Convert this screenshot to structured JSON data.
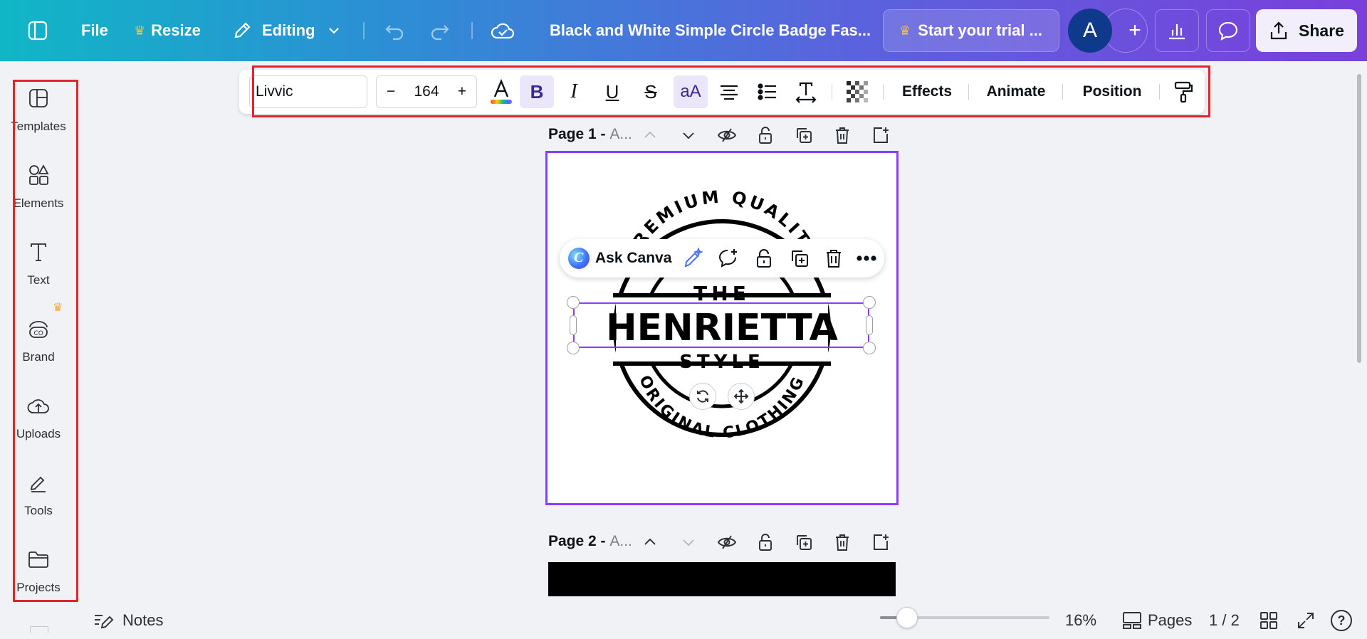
{
  "header": {
    "file_label": "File",
    "resize_label": "Resize",
    "editing_label": "Editing",
    "doc_title": "Black and White Simple Circle Badge Fas...",
    "trial_label": "Start your trial ...",
    "avatar_letter": "A",
    "plus_label": "+",
    "share_label": "Share"
  },
  "sidebar": {
    "items": [
      {
        "label": "Templates",
        "icon": "templates-icon"
      },
      {
        "label": "Elements",
        "icon": "elements-icon"
      },
      {
        "label": "Text",
        "icon": "text-icon"
      },
      {
        "label": "Brand",
        "icon": "brand-icon"
      },
      {
        "label": "Uploads",
        "icon": "uploads-icon"
      },
      {
        "label": "Tools",
        "icon": "tools-icon"
      },
      {
        "label": "Projects",
        "icon": "projects-icon"
      }
    ]
  },
  "toolbar": {
    "font_name": "Livvic",
    "minus": "−",
    "font_size": "164",
    "plus": "+",
    "bold": "B",
    "italic": "I",
    "underline": "U",
    "strike": "S",
    "case": "aA",
    "effects_label": "Effects",
    "animate_label": "Animate",
    "position_label": "Position"
  },
  "pages": {
    "page1_label": "Page 1 - ",
    "page1_suffix": "A...",
    "page2_label": "Page 2 - ",
    "page2_suffix": "A..."
  },
  "design": {
    "top_arc_text": "PREMIUM QUALITY",
    "the_text": "THE",
    "main_text": "HENRIETTA",
    "style_text": "STYLE",
    "bottom_arc_text": "ORIGINAL CLOTHING"
  },
  "ask_bar": {
    "label": "Ask Canva"
  },
  "bottom": {
    "notes_label": "Notes",
    "zoom_level": "16%",
    "zoom_value": 16,
    "pages_label": "Pages",
    "page_counter": "1 / 2",
    "help_label": "?"
  },
  "colors": {
    "accent": "#8b3dff",
    "highlight": "#e4232d",
    "crown": "#f5a623"
  }
}
